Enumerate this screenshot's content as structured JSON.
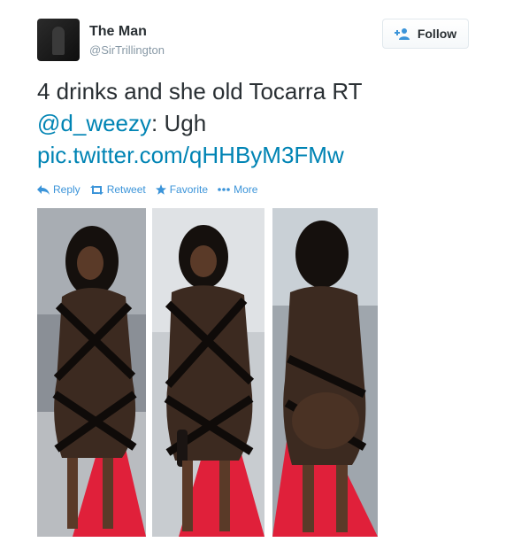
{
  "user": {
    "name": "The Man",
    "handle": "@SirTrillington"
  },
  "follow_label": "Follow",
  "tweet": {
    "text": "4 drinks and she old Tocarra RT",
    "mention": "@d_weezy",
    "after_mention": ": Ugh",
    "link": "pic.twitter.com/qHHByM3FMw"
  },
  "actions": [
    {
      "label": "Reply",
      "icon": "reply-icon"
    },
    {
      "label": "Retweet",
      "icon": "retweet-icon"
    },
    {
      "label": "Favorite",
      "icon": "star-icon"
    },
    {
      "label": "More",
      "icon": "more-icon"
    }
  ],
  "colors": {
    "link": "#0084b4",
    "action": "#3b94d9",
    "text": "#292f33",
    "muted": "#8899a6",
    "carpet": "#e0203a"
  },
  "photo": {
    "panels": 3
  }
}
